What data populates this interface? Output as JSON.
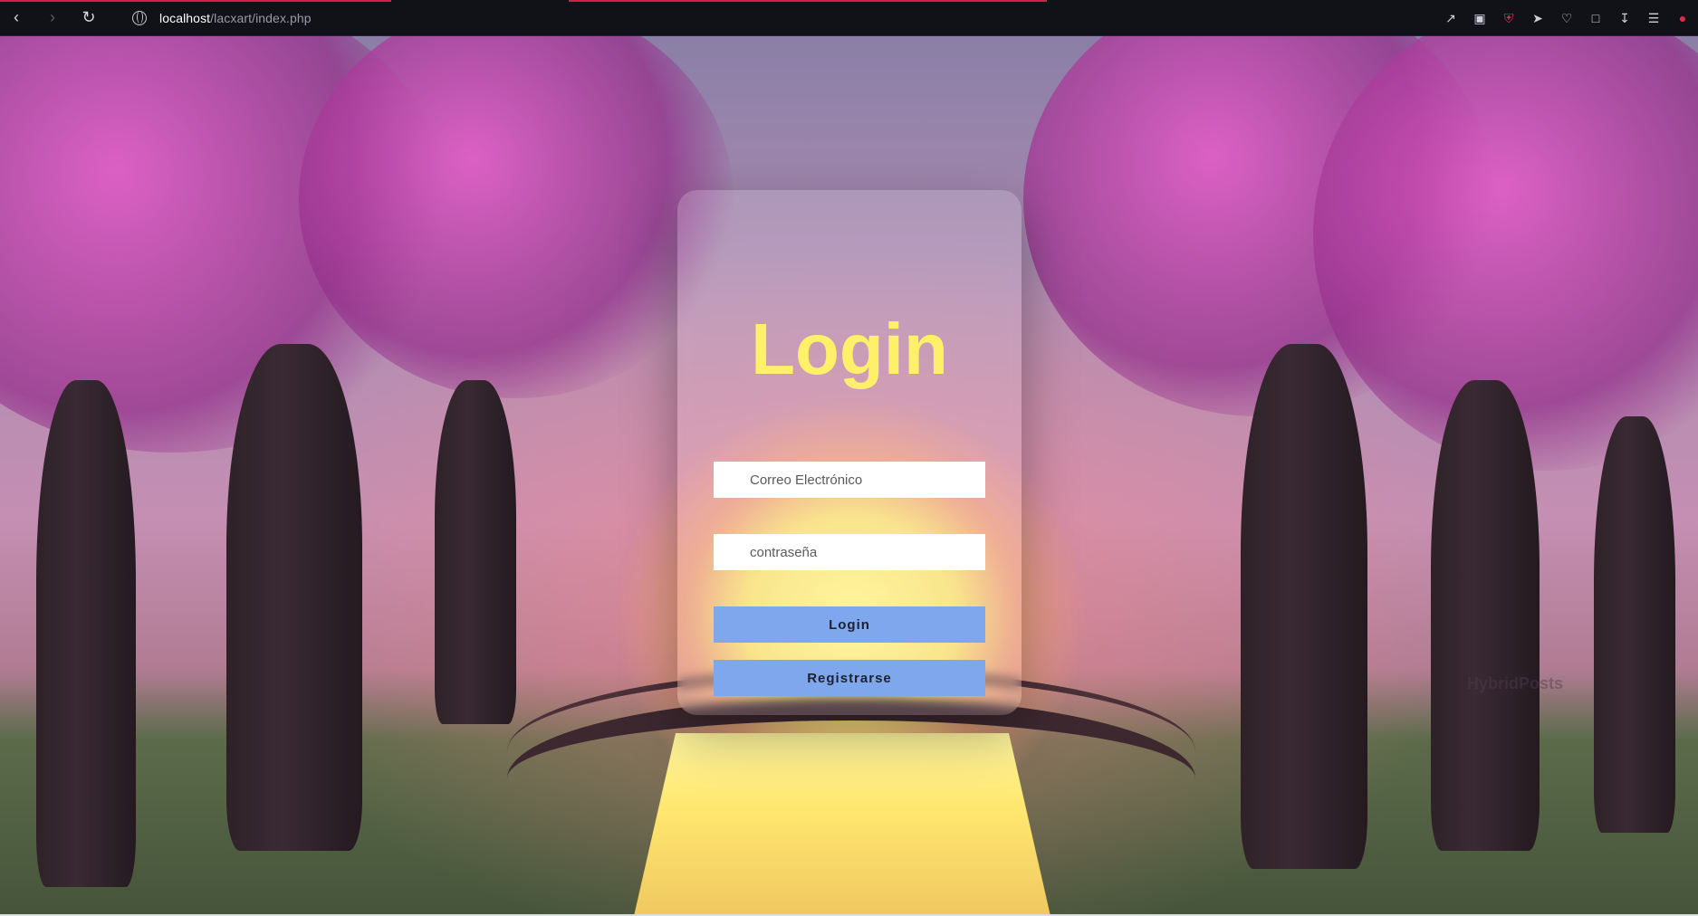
{
  "browser": {
    "url_host": "localhost",
    "url_path": "/lacxart/index.php",
    "icons": [
      "back-icon",
      "forward-icon",
      "reload-icon",
      "site-info-icon",
      "share-icon",
      "camera-icon",
      "shield-icon",
      "send-icon",
      "heart-icon",
      "cube-icon",
      "download-icon",
      "menu-icon",
      "profile-icon"
    ],
    "accent": "#d6204a"
  },
  "page": {
    "watermark": "HybridPosts"
  },
  "login": {
    "title": "Login",
    "email_placeholder": "Correo Electrónico",
    "password_placeholder": "contraseña",
    "login_label": "Login",
    "register_label": "Registrarse",
    "colors": {
      "title": "#fff06a",
      "button": "#7ea7ee"
    }
  }
}
